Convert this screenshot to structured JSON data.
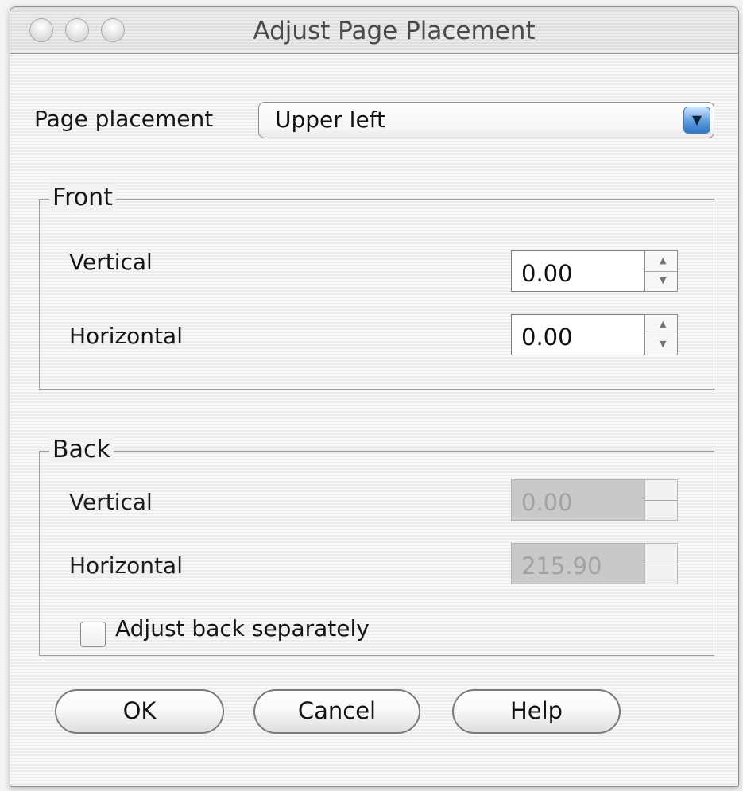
{
  "window": {
    "title": "Adjust Page Placement"
  },
  "page_placement": {
    "label": "Page placement",
    "selected": "Upper left",
    "arrow_icon": "▼"
  },
  "front": {
    "legend": "Front",
    "vertical_label": "Vertical",
    "vertical_value": "0.00",
    "horizontal_label": "Horizontal",
    "horizontal_value": "0.00"
  },
  "back": {
    "legend": "Back",
    "vertical_label": "Vertical",
    "vertical_value": "0.00",
    "horizontal_label": "Horizontal",
    "horizontal_value": "215.90",
    "checkbox_label": "Adjust back separately"
  },
  "buttons": {
    "ok": "OK",
    "cancel": "Cancel",
    "help": "Help"
  },
  "spinner": {
    "up": "▲",
    "down": "▼"
  }
}
